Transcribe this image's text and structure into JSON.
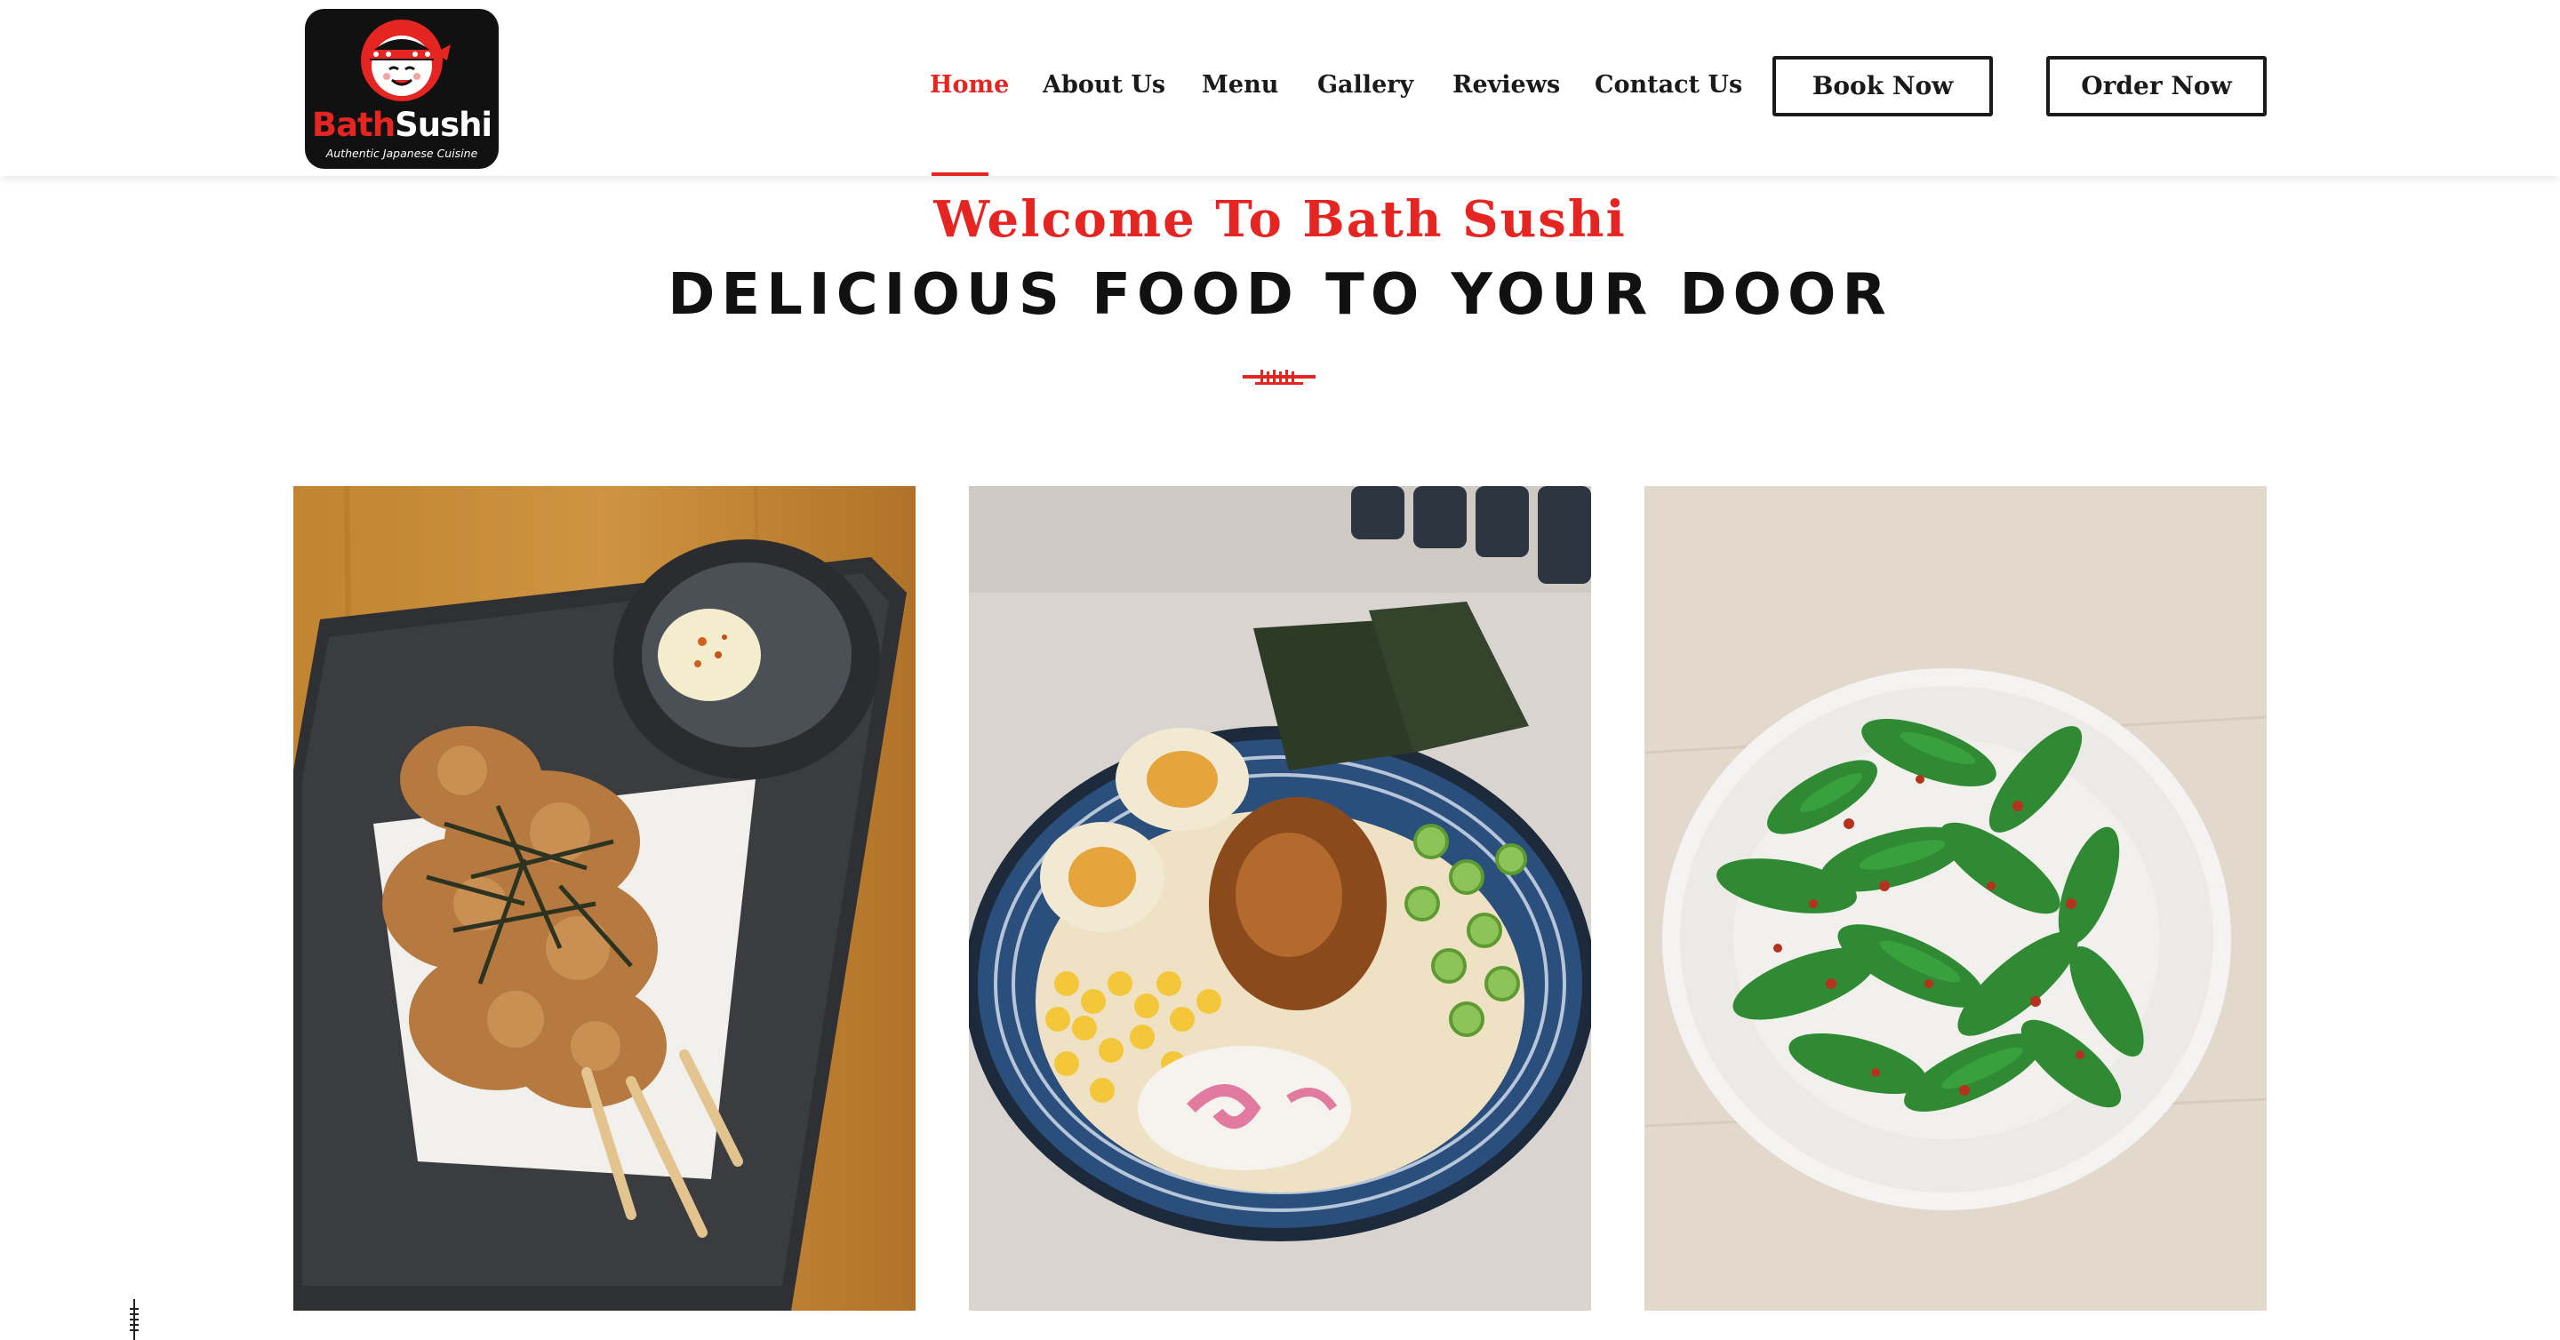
{
  "brand": {
    "name_part1": "Bath",
    "name_part2": "Sushi",
    "tagline": "Authentic Japanese Cuisine",
    "logo_icon": "sushi-chef-mascot-icon"
  },
  "nav": {
    "items": [
      {
        "label": "Home",
        "active": true
      },
      {
        "label": "About Us",
        "active": false
      },
      {
        "label": "Menu",
        "active": false
      },
      {
        "label": "Gallery",
        "active": false
      },
      {
        "label": "Reviews",
        "active": false
      },
      {
        "label": "Contact Us",
        "active": false
      }
    ],
    "book_label": "Book Now",
    "order_label": "Order Now"
  },
  "intro": {
    "welcome": "Welcome To Bath Sushi",
    "headline": "DELICIOUS FOOD TO YOUR DOOR",
    "divider_icon": "chopsticks-divider-icon"
  },
  "gallery": {
    "photos": [
      {
        "subject": "fried chicken skewers with dipping sauce"
      },
      {
        "subject": "tonkotsu ramen bowl"
      },
      {
        "subject": "spicy edamame"
      }
    ]
  },
  "colors": {
    "accent": "#e52521",
    "text": "#1a1a1a",
    "background": "#ffffff"
  }
}
